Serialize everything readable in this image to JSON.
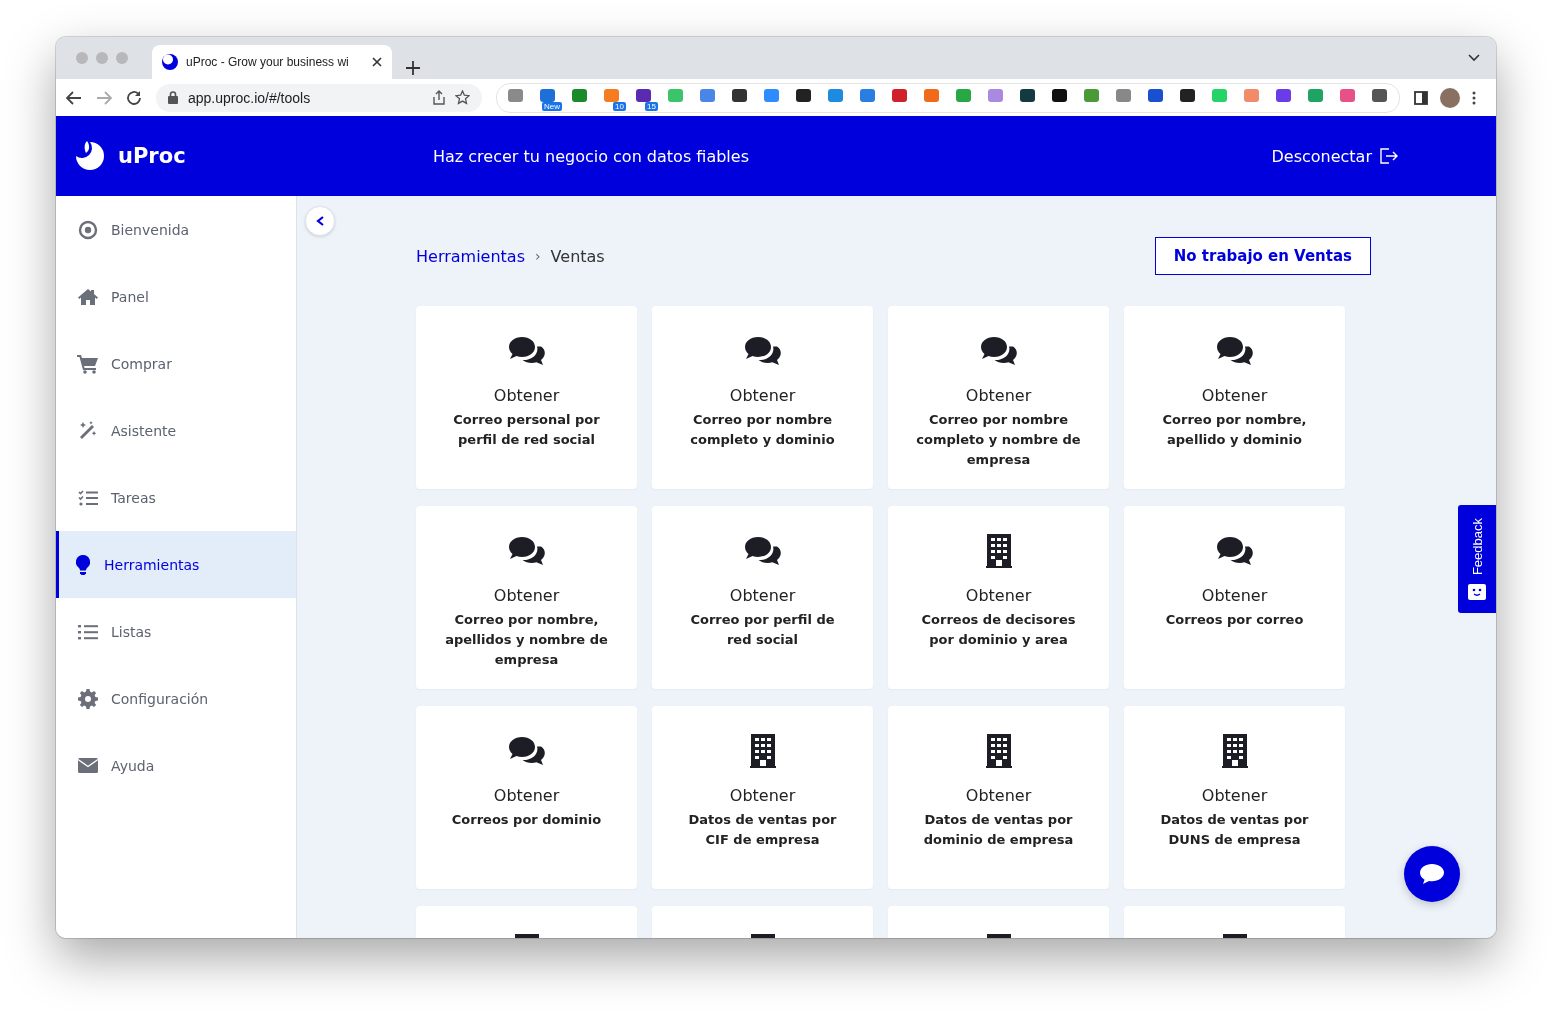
{
  "browser": {
    "tab_title": "uProc - Grow your business wi",
    "url": "app.uproc.io/#/tools",
    "extensions": [
      {
        "color": "#8a8a8a"
      },
      {
        "color": "#1f6fd8",
        "badge": "New"
      },
      {
        "color": "#1a8a2a"
      },
      {
        "color": "#f57c20",
        "badge": "10"
      },
      {
        "color": "#5a2bb0",
        "badge": "15"
      },
      {
        "color": "#3cc46a"
      },
      {
        "color": "#4a86e8"
      },
      {
        "color": "#333333"
      },
      {
        "color": "#2d8cff"
      },
      {
        "color": "#222222"
      },
      {
        "color": "#1d8ce0"
      },
      {
        "color": "#2a7de1"
      },
      {
        "color": "#d0202a"
      },
      {
        "color": "#f06a1a"
      },
      {
        "color": "#27a844"
      },
      {
        "color": "#a98ae0"
      },
      {
        "color": "#123a40"
      },
      {
        "color": "#111111"
      },
      {
        "color": "#4a9a3a"
      },
      {
        "color": "#888888"
      },
      {
        "color": "#1a4fd0"
      },
      {
        "color": "#222222"
      },
      {
        "color": "#25d366"
      },
      {
        "color": "#f28b6a"
      },
      {
        "color": "#6a3de8"
      },
      {
        "color": "#1fa463"
      },
      {
        "color": "#e8508a"
      },
      {
        "color": "#555555"
      }
    ]
  },
  "header": {
    "brand": "uProc",
    "tagline": "Haz crecer tu negocio con datos fiables",
    "logout": "Desconectar"
  },
  "sidebar": {
    "items": [
      {
        "kind": "target",
        "label": "Bienvenida",
        "selected": false
      },
      {
        "kind": "home",
        "label": "Panel",
        "selected": false
      },
      {
        "kind": "cart",
        "label": "Comprar",
        "selected": false
      },
      {
        "kind": "wand",
        "label": "Asistente",
        "selected": false
      },
      {
        "kind": "tasks",
        "label": "Tareas",
        "selected": false
      },
      {
        "kind": "bulb",
        "label": "Herramientas",
        "selected": true
      },
      {
        "kind": "list",
        "label": "Listas",
        "selected": false
      },
      {
        "kind": "gear",
        "label": "Configuración",
        "selected": false
      },
      {
        "kind": "envelope",
        "label": "Ayuda",
        "selected": false
      }
    ]
  },
  "breadcrumb": [
    {
      "label": "Herramientas",
      "kind": "link"
    },
    {
      "label": "Ventas",
      "kind": "current"
    }
  ],
  "breadcrumb_separator": "›",
  "action_button": "No trabajo en Ventas",
  "cards": [
    {
      "kind": "chat",
      "verb": "Obtener",
      "title": "Correo personal por perfil de red social"
    },
    {
      "kind": "chat",
      "verb": "Obtener",
      "title": "Correo por nombre completo y dominio"
    },
    {
      "kind": "chat",
      "verb": "Obtener",
      "title": "Correo por nombre completo y nombre de empresa"
    },
    {
      "kind": "chat",
      "verb": "Obtener",
      "title": "Correo por nombre, apellido y dominio"
    },
    {
      "kind": "chat",
      "verb": "Obtener",
      "title": "Correo por nombre, apellidos y nombre de empresa"
    },
    {
      "kind": "chat",
      "verb": "Obtener",
      "title": "Correo por perfil de red social"
    },
    {
      "kind": "building",
      "verb": "Obtener",
      "title": "Correos de decisores por dominio y area"
    },
    {
      "kind": "chat",
      "verb": "Obtener",
      "title": "Correos por correo"
    },
    {
      "kind": "chat",
      "verb": "Obtener",
      "title": "Correos por dominio"
    },
    {
      "kind": "building",
      "verb": "Obtener",
      "title": "Datos de ventas por CIF de empresa"
    },
    {
      "kind": "building",
      "verb": "Obtener",
      "title": "Datos de ventas por dominio de empresa"
    },
    {
      "kind": "building",
      "verb": "Obtener",
      "title": "Datos de ventas por DUNS de empresa"
    },
    {
      "kind": "building"
    },
    {
      "kind": "building"
    },
    {
      "kind": "building"
    },
    {
      "kind": "building"
    }
  ],
  "feedback_tab": "Feedback"
}
